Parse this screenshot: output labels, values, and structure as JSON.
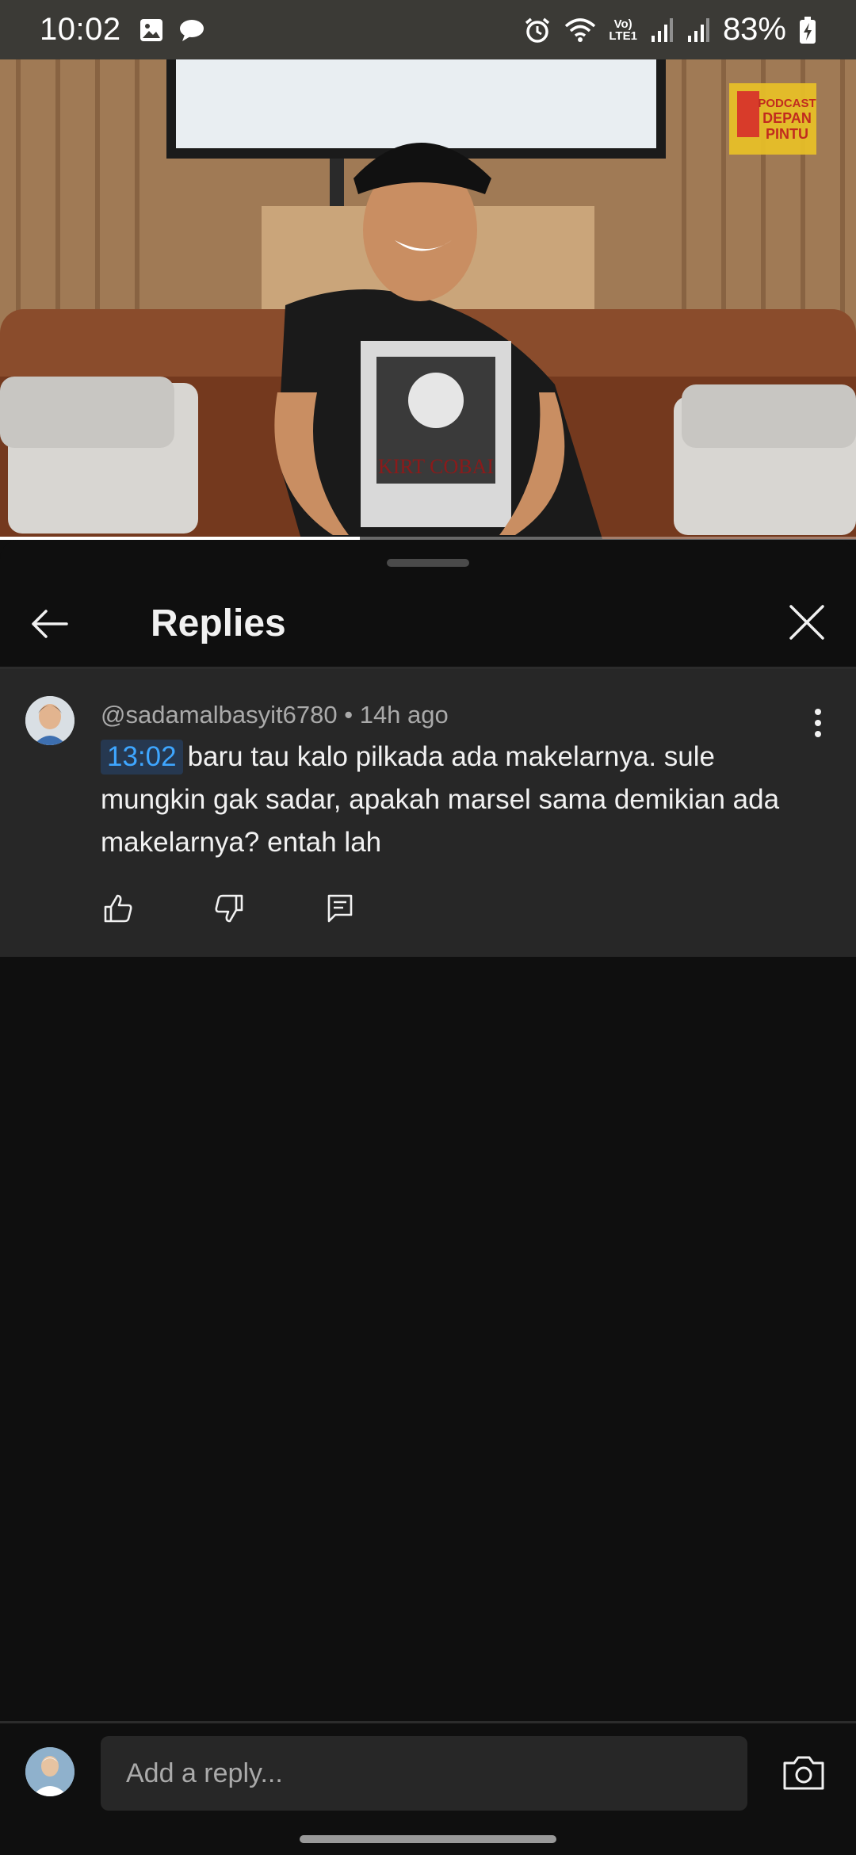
{
  "status_bar": {
    "time": "10:02",
    "battery": "83%",
    "left_icons": [
      "gallery-icon",
      "chat-bubble-icon"
    ],
    "right_icons": [
      "alarm-icon",
      "wifi-icon",
      "volte-icon",
      "signal-icon",
      "signal-icon",
      "battery-charging-icon"
    ],
    "volte_label_top": "Vo)",
    "volte_label_bottom": "LTE1"
  },
  "video": {
    "progress_fraction": 0.42,
    "shirt_text": "KIRT COBAI",
    "watermark_line1": "PODCAST",
    "watermark_line2": "DEPAN",
    "watermark_line3": "PINTU"
  },
  "panel": {
    "title": "Replies",
    "back_icon": "arrow-left-icon",
    "close_icon": "close-icon"
  },
  "comment": {
    "author": "@sadamalbasyit6780",
    "separator": "•",
    "age": "14h ago",
    "timestamp": "13:02",
    "text": "baru tau kalo pilkada ada makelarnya. sule mungkin gak sadar, apakah marsel sama demikian ada makelarnya? entah lah",
    "actions": [
      "like-icon",
      "dislike-icon",
      "reply-icon"
    ]
  },
  "reply_bar": {
    "placeholder": "Add a reply...",
    "camera_icon": "camera-icon"
  },
  "colors": {
    "background": "#0f0f0f",
    "comment_bg": "#272727",
    "link": "#3ea6ff",
    "status_bar": "#3b3a36"
  }
}
